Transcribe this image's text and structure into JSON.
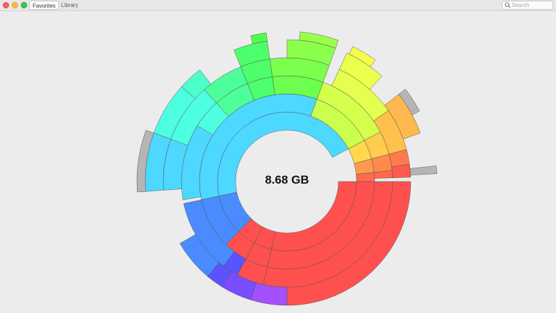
{
  "window": {
    "tabs": [
      {
        "label": "Favorites",
        "active": true
      },
      {
        "label": "Library",
        "active": false
      }
    ],
    "search": {
      "placeholder": "Search",
      "value": ""
    }
  },
  "sunburst": {
    "total_label": "8.68 GB"
  },
  "colors": {
    "background": "#ececec",
    "ring_stroke": "#555555",
    "other_gray": "#b5b5b5"
  },
  "icons": [
    "close-button",
    "minimize-button",
    "zoom-button",
    "search-icon"
  ]
}
